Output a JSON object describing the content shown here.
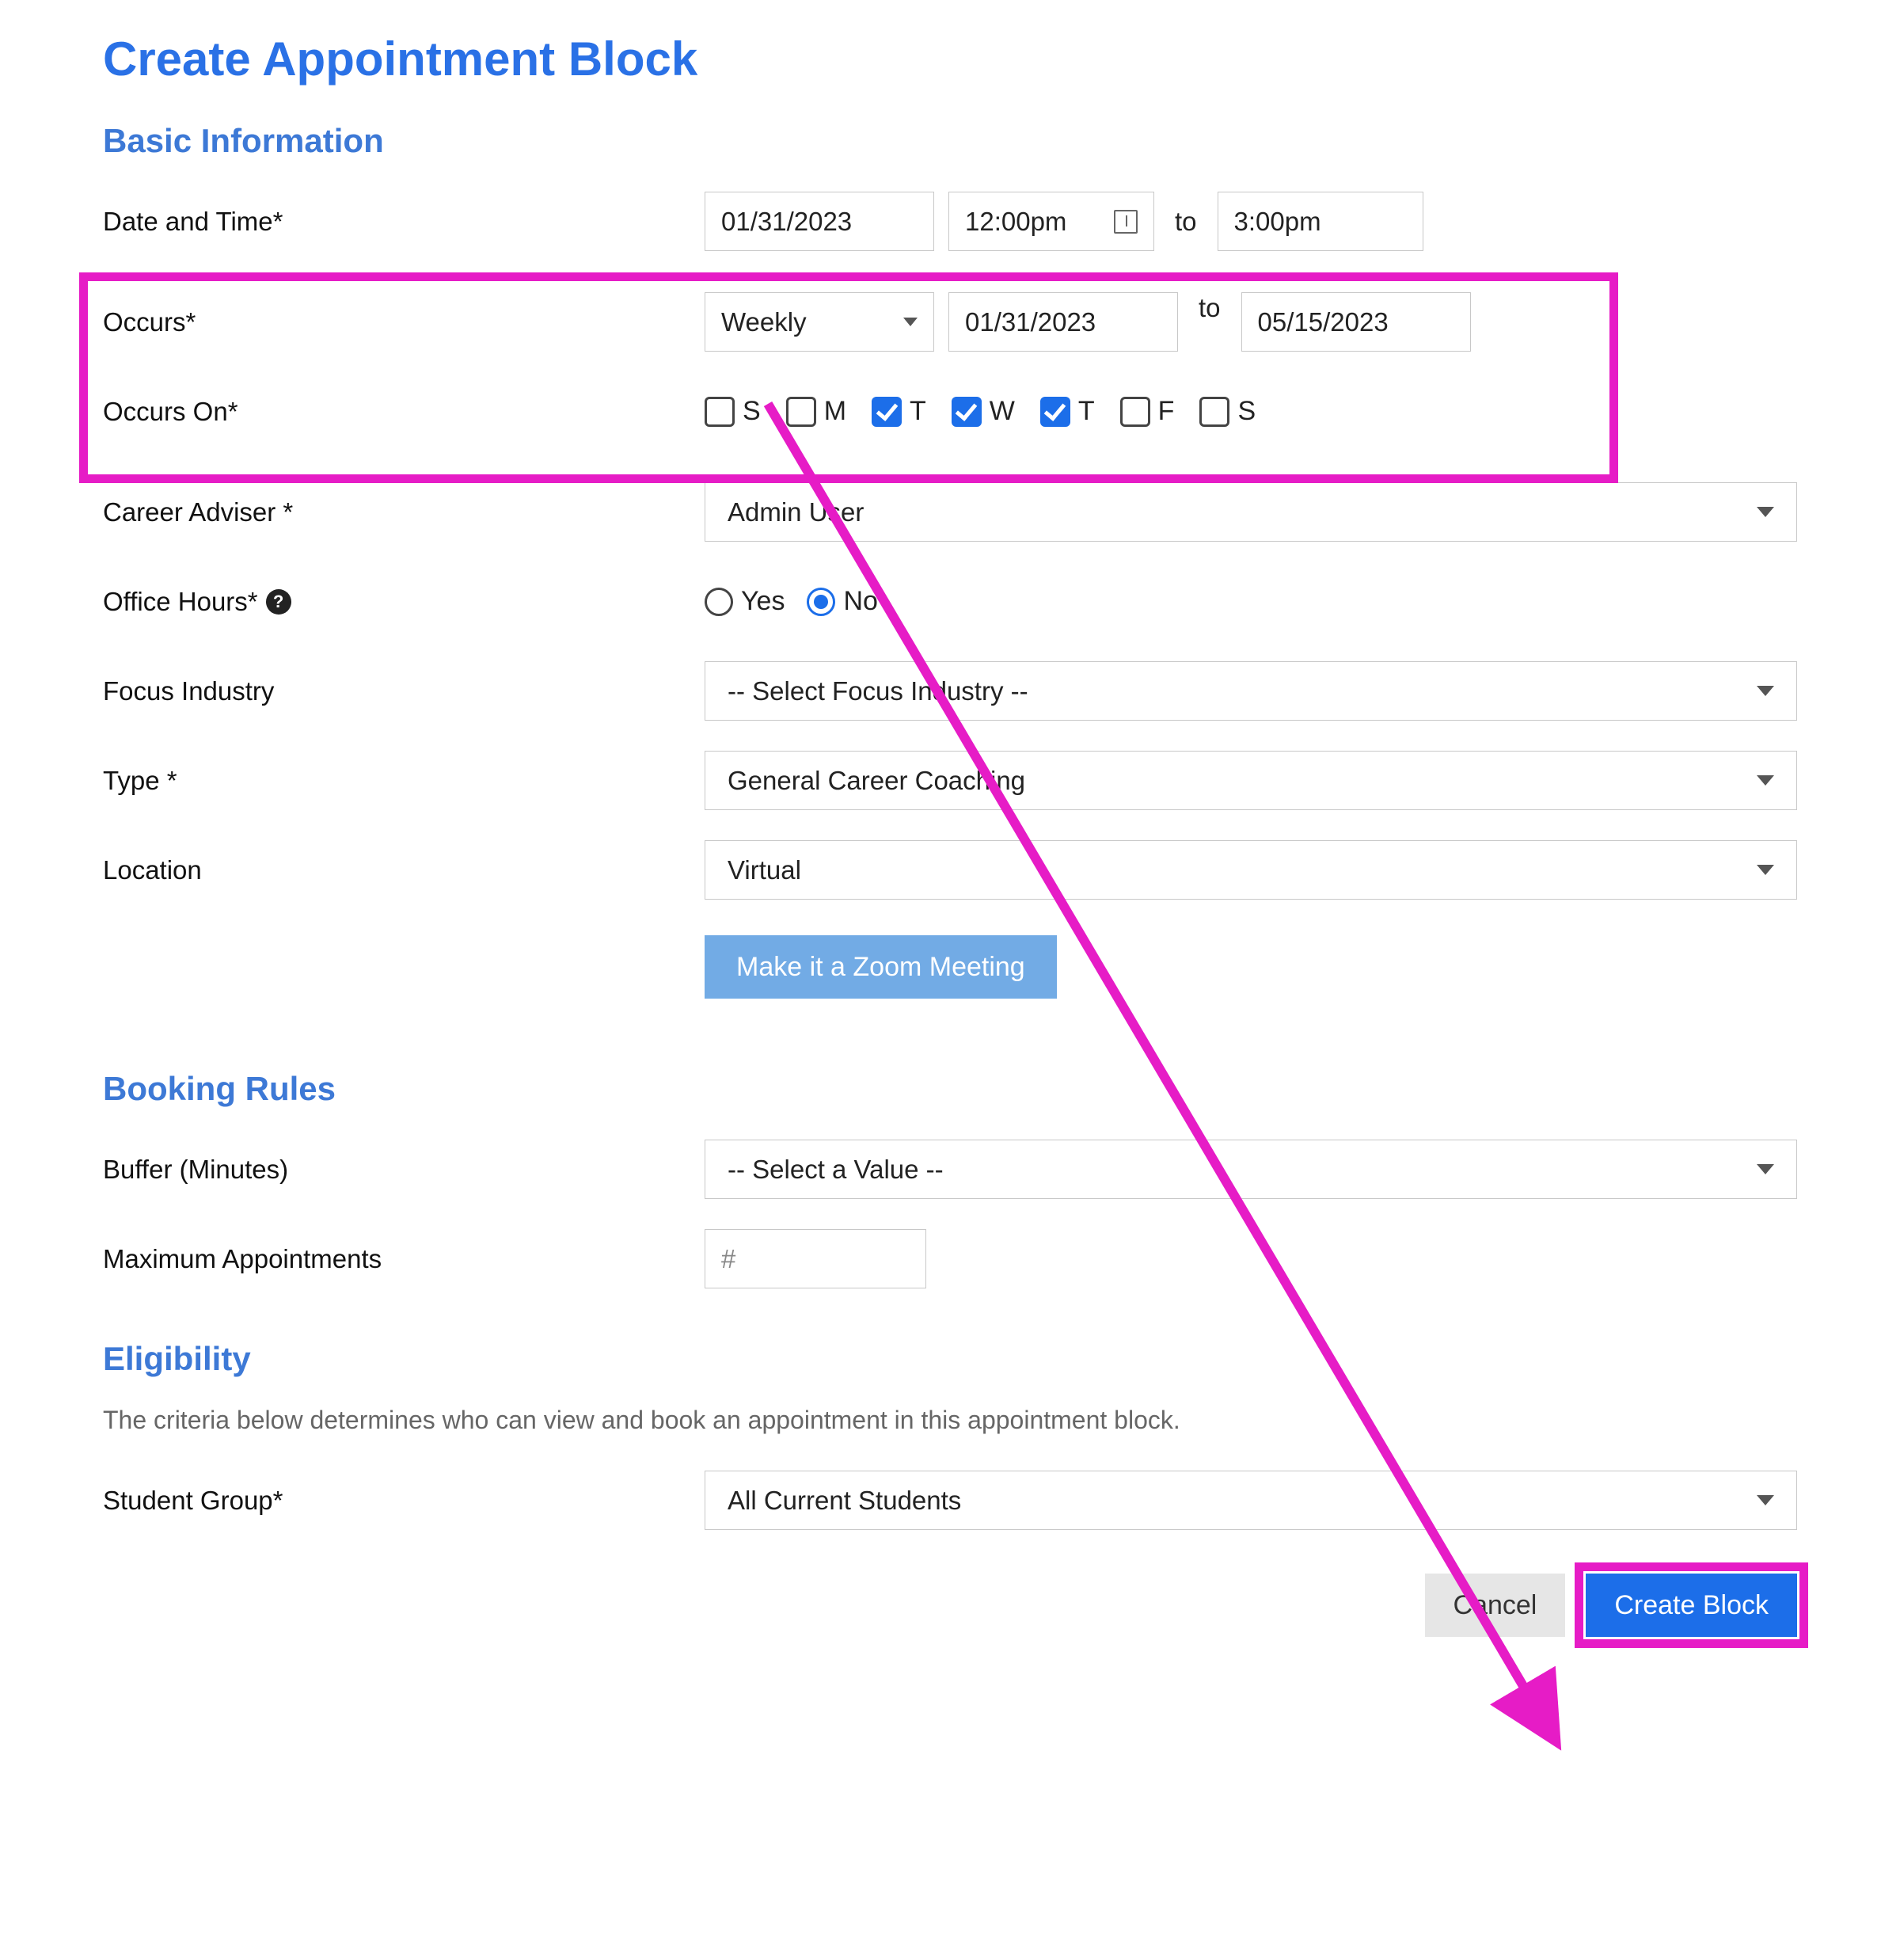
{
  "page_title": "Create Appointment Block",
  "sections": {
    "basic_info": {
      "title": "Basic Information",
      "date_time_label": "Date and Time*",
      "date_value": "01/31/2023",
      "start_time": "12:00pm",
      "end_time": "3:00pm",
      "to_text": "to",
      "occurs_label": "Occurs*",
      "occurs_freq": "Weekly",
      "occurs_start": "01/31/2023",
      "occurs_end": "05/15/2023",
      "occurs_on_label": "Occurs On*",
      "days": [
        {
          "label": "S",
          "checked": false
        },
        {
          "label": "M",
          "checked": false
        },
        {
          "label": "T",
          "checked": true
        },
        {
          "label": "W",
          "checked": true
        },
        {
          "label": "T",
          "checked": true
        },
        {
          "label": "F",
          "checked": false
        },
        {
          "label": "S",
          "checked": false
        }
      ],
      "adviser_label": "Career Adviser *",
      "adviser_value": "Admin User",
      "office_hours_label": "Office Hours*",
      "office_yes": "Yes",
      "office_no": "No",
      "focus_label": "Focus Industry",
      "focus_value": "-- Select Focus Industry --",
      "type_label": "Type *",
      "type_value": "General Career Coaching",
      "location_label": "Location",
      "location_value": "Virtual",
      "zoom_btn": "Make it a Zoom Meeting"
    },
    "booking": {
      "title": "Booking Rules",
      "buffer_label": "Buffer (Minutes)",
      "buffer_value": "-- Select a Value --",
      "max_label": "Maximum Appointments",
      "max_placeholder": "#"
    },
    "eligibility": {
      "title": "Eligibility",
      "desc": "The criteria below determines who can view and book an appointment in this appointment block.",
      "group_label": "Student Group*",
      "group_value": "All Current Students"
    }
  },
  "buttons": {
    "cancel": "Cancel",
    "create": "Create Block"
  }
}
